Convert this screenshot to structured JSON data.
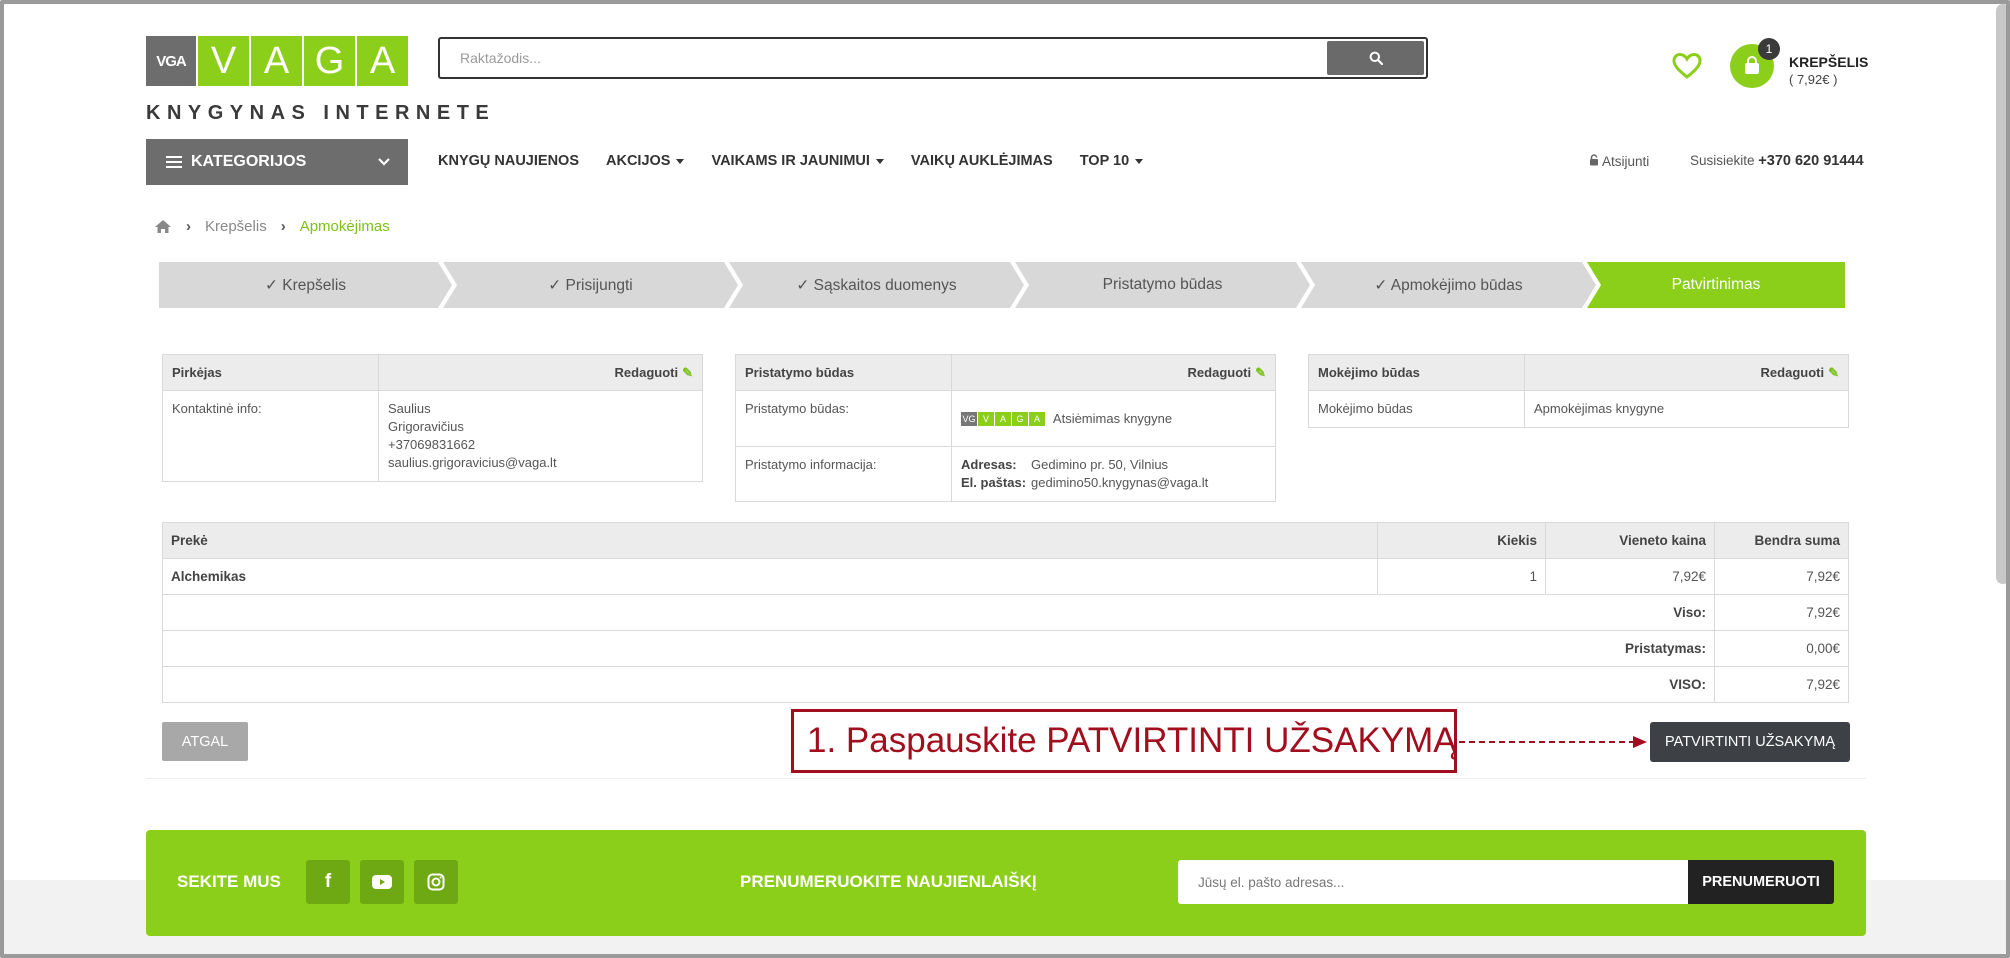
{
  "header": {
    "logo_mark": "VGA",
    "logo_letters": [
      "V",
      "A",
      "G",
      "A"
    ],
    "logo_subtitle": "KNYGYNAS INTERNETE",
    "search_placeholder": "Raktažodis...",
    "cart_count": "1",
    "cart_title": "KREPŠELIS",
    "cart_total": "( 7,92€ )"
  },
  "nav": {
    "categories_label": "KATEGORIJOS",
    "items": [
      {
        "label": "KNYGŲ NAUJIENOS",
        "dropdown": false
      },
      {
        "label": "AKCIJOS",
        "dropdown": true
      },
      {
        "label": "VAIKAMS IR JAUNIMUI",
        "dropdown": true
      },
      {
        "label": "VAIKŲ AUKLĖJIMAS",
        "dropdown": false
      },
      {
        "label": "TOP 10",
        "dropdown": true
      }
    ],
    "logout": "Atsijunti",
    "contact_label": "Susisiekite",
    "phone": "+370 620 91444"
  },
  "breadcrumb": {
    "items": [
      "Krepšelis",
      "Apmokėjimas"
    ]
  },
  "steps": [
    {
      "label": "✓  Krepšelis",
      "state": "done"
    },
    {
      "label": "✓  Prisijungti",
      "state": "done"
    },
    {
      "label": "✓  Sąskaitos duomenys",
      "state": "done"
    },
    {
      "label": "Pristatymo būdas",
      "state": "pending"
    },
    {
      "label": "✓  Apmokėjimo būdas",
      "state": "done"
    },
    {
      "label": "Patvirtinimas",
      "state": "active"
    }
  ],
  "buyer": {
    "title": "Pirkėjas",
    "edit": "Redaguoti",
    "contact_label": "Kontaktinė info:",
    "first_name": "Saulius",
    "last_name": "Grigoravičius",
    "phone": "+37069831662",
    "email": "saulius.grigoravicius@vaga.lt"
  },
  "delivery": {
    "title": "Pristatymo būdas",
    "edit": "Redaguoti",
    "method_label": "Pristatymo būdas:",
    "method_value": "Atsiėmimas knygyne",
    "info_label": "Pristatymo informacija:",
    "address_label": "Adresas:",
    "address_value": "Gedimino pr. 50, Vilnius",
    "email_label": "El. paštas:",
    "email_value": "gedimino50.knygynas@vaga.lt"
  },
  "payment": {
    "title": "Mokėjimo būdas",
    "edit": "Redaguoti",
    "label": "Mokėjimo būdas",
    "value": "Apmokėjimas knygyne"
  },
  "order": {
    "headers": {
      "product": "Prekė",
      "qty": "Kiekis",
      "unit": "Vieneto kaina",
      "total": "Bendra suma"
    },
    "rows": [
      {
        "product": "Alchemikas",
        "qty": "1",
        "unit": "7,92€",
        "total": "7,92€"
      }
    ],
    "summary": [
      {
        "label": "Viso:",
        "value": "7,92€"
      },
      {
        "label": "Pristatymas:",
        "value": "0,00€"
      },
      {
        "label": "VISO:",
        "value": "7,92€"
      }
    ]
  },
  "actions": {
    "back": "ATGAL",
    "confirm": "PATVIRTINTI UŽSAKYMĄ",
    "callout": "1. Paspauskite PATVIRTINTI UŽSAKYMĄ"
  },
  "footer": {
    "follow": "SEKITE MUS",
    "social_icons": [
      "facebook-icon",
      "youtube-icon",
      "instagram-icon"
    ],
    "newsletter": "PRENUMERUOKITE NAUJIENLAIŠKĮ",
    "email_placeholder": "Jūsų el. pašto adresas...",
    "subscribe": "PRENUMERUOTI"
  },
  "colors": {
    "brand_green": "#8ccf1a",
    "dark": "#3d4045",
    "callout_red": "#a10e1e"
  }
}
